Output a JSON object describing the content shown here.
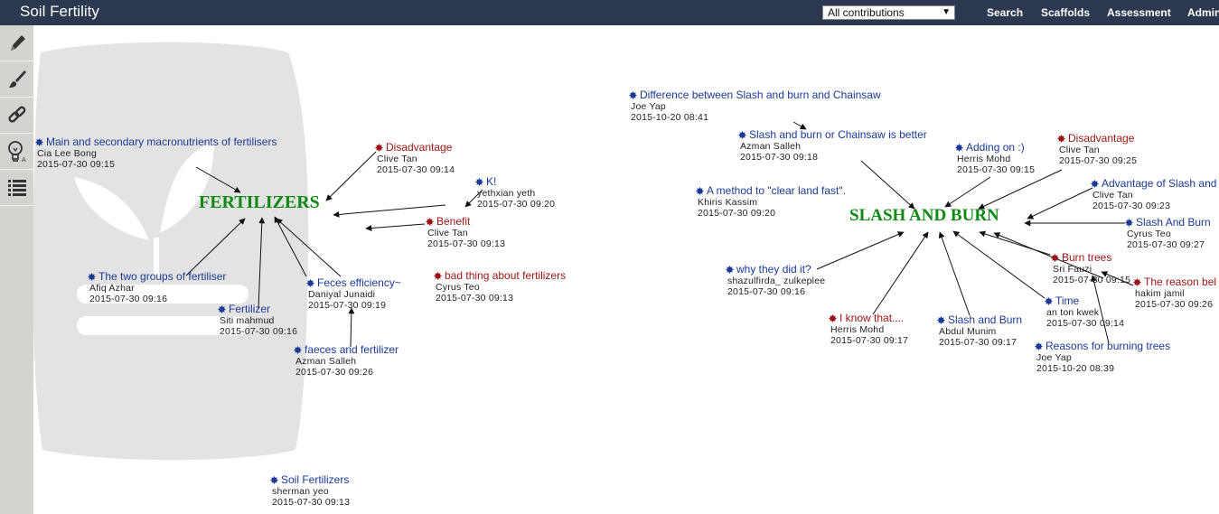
{
  "app": {
    "title": "Soil Fertility"
  },
  "header": {
    "view_select": "All contributions",
    "nav": [
      "Search",
      "Scaffolds",
      "Assessment",
      "Admin"
    ]
  },
  "toolbar": [
    "pencil-icon",
    "brush-icon",
    "link-icon",
    "lightbulb-icon",
    "list-icon"
  ],
  "topics": {
    "fertilizers": "FERTILIZERS",
    "slash": "SLASH AND BURN"
  },
  "colors": {
    "header_bg": "#2b3850",
    "note_blue": "#1a3a96",
    "note_red": "#9b1313",
    "topic_green": "#0e8a14"
  },
  "notes": [
    {
      "title": "Main and secondary macronutrients of fertilisers",
      "author": "Cia Lee Bong",
      "date": "2015-07-30 09:15",
      "kind": "blue"
    },
    {
      "title": "Disadvantage",
      "author": "Clive Tan",
      "date": "2015-07-30 09:14",
      "kind": "red"
    },
    {
      "title": "K!",
      "author": "yethxian yeth",
      "date": "2015-07-30 09:20",
      "kind": "blue"
    },
    {
      "title": "Benefit",
      "author": "Clive Tan",
      "date": "2015-07-30 09:13",
      "kind": "red"
    },
    {
      "title": "bad thing about fertilizers",
      "author": "Cyrus Teo",
      "date": "2015-07-30 09:13",
      "kind": "red"
    },
    {
      "title": "The two groups of fertiliser",
      "author": "Afiq Azhar",
      "date": "2015-07-30 09:16",
      "kind": "blue"
    },
    {
      "title": "Fertilizer",
      "author": "Siti mahmud",
      "date": "2015-07-30 09:16",
      "kind": "blue"
    },
    {
      "title": "Feces efficiency~",
      "author": "Daniyal Junaidi",
      "date": "2015-07-30 09:19",
      "kind": "blue"
    },
    {
      "title": "faeces and fertilizer",
      "author": "Azman Salleh",
      "date": "2015-07-30 09:26",
      "kind": "blue"
    },
    {
      "title": "Soil Fertilizers",
      "author": "sherman yeo",
      "date": "2015-07-30 09:13",
      "kind": "blue"
    },
    {
      "title": "Difference between Slash and burn and Chainsaw",
      "author": "Joe Yap",
      "date": "2015-10-20 08:41",
      "kind": "blue"
    },
    {
      "title": "Slash and burn or Chainsaw is better",
      "author": "Azman Salleh",
      "date": "2015-07-30 09:18",
      "kind": "blue"
    },
    {
      "title": "Adding on :)",
      "author": "Herris Mohd",
      "date": "2015-07-30 09:15",
      "kind": "blue"
    },
    {
      "title": "Disadvantage",
      "author": "Clive Tan",
      "date": "2015-07-30 09:25",
      "kind": "red"
    },
    {
      "title": "A method to \"clear land fast\".",
      "author": "Khiris Kassim",
      "date": "2015-07-30 09:20",
      "kind": "blue"
    },
    {
      "title": "Advantage of Slash and",
      "author": "Clive Tan",
      "date": "2015-07-30 09:23",
      "kind": "blue"
    },
    {
      "title": "Slash And Burn",
      "author": "Cyrus Teo",
      "date": "2015-07-30 09:27",
      "kind": "blue"
    },
    {
      "title": "why they did it?",
      "author": "shazulfirda_ zulkeplee",
      "date": "2015-07-30 09:16",
      "kind": "blue"
    },
    {
      "title": "Burn trees",
      "author": "Sri Fauzi",
      "date": "2015-07-30 09:15",
      "kind": "red"
    },
    {
      "title": "The reason bel",
      "author": "hakim jamil",
      "date": "2015-07-30 09:26",
      "kind": "red"
    },
    {
      "title": "Time",
      "author": "an ton kwek",
      "date": "2015-07-30 09:14",
      "kind": "blue"
    },
    {
      "title": "I know that....",
      "author": "Herris Mohd",
      "date": "2015-07-30 09:17",
      "kind": "red"
    },
    {
      "title": "Slash and Burn",
      "author": "Abdul Munim",
      "date": "2015-07-30 09:17",
      "kind": "blue"
    },
    {
      "title": "Reasons for burning trees",
      "author": "Joe Yap",
      "date": "2015-10-20 08:39",
      "kind": "blue"
    }
  ]
}
